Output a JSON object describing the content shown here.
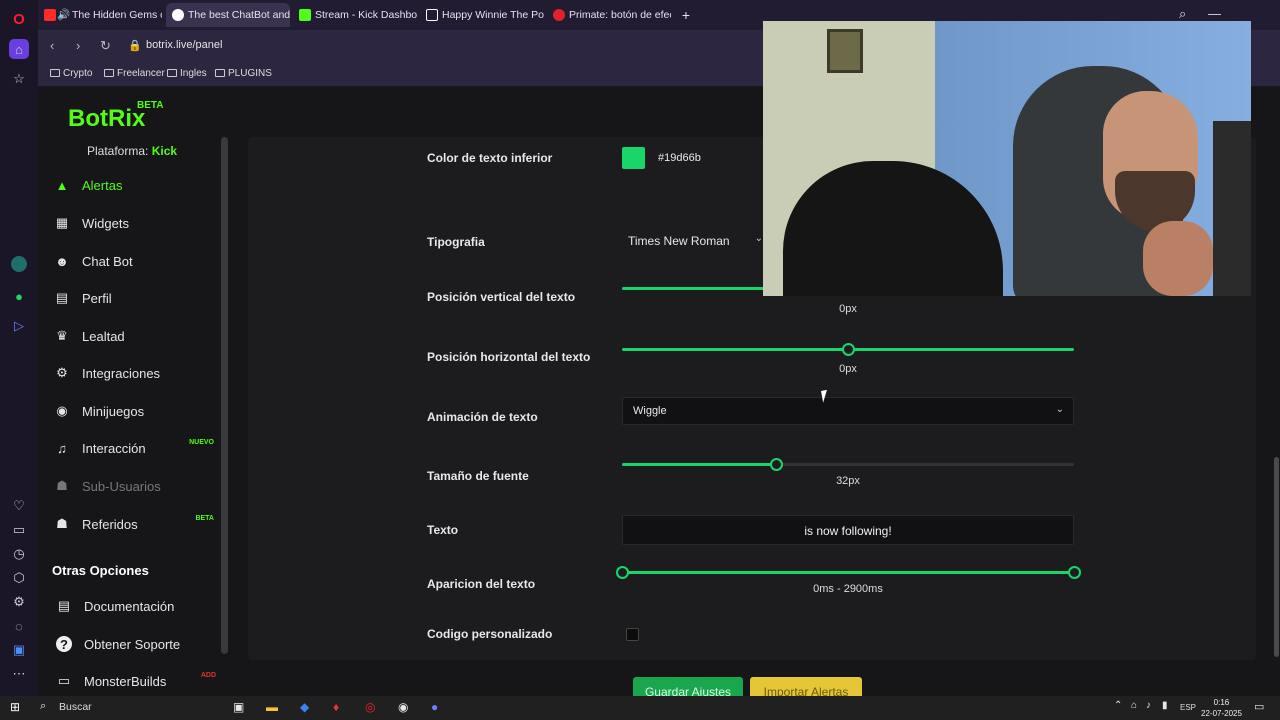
{
  "browser": {
    "tabs": [
      {
        "label": "The Hidden Gems of A",
        "fav_color": "#ff2a2a",
        "audio": "🔊"
      },
      {
        "label": "The best ChatBot and We",
        "fav_color": "#ffffff"
      },
      {
        "label": "Stream - Kick Dashboard",
        "fav_color": "#53fc18"
      },
      {
        "label": "Happy Winnie The Pooh G",
        "fav_color": "#ffffff"
      },
      {
        "label": "Primate: botón de efectos",
        "fav_color": "#e0222a"
      }
    ],
    "new_tab": "+",
    "url": "botrix.live/panel",
    "bookmarks": [
      "Crypto",
      "Freelancer",
      "Ingles",
      "PLUGINS"
    ]
  },
  "brand": {
    "name": "BotRix",
    "beta": "BETA"
  },
  "sidebar": {
    "platform_label": "Plataforma:",
    "platform_value": "Kick",
    "items": [
      {
        "label": "Alertas",
        "icon": "▲"
      },
      {
        "label": "Widgets",
        "icon": "▦"
      },
      {
        "label": "Chat Bot",
        "icon": "☻"
      },
      {
        "label": "Perfil",
        "icon": "▤"
      },
      {
        "label": "Lealtad",
        "icon": "♛"
      },
      {
        "label": "Integraciones",
        "icon": "⚙"
      },
      {
        "label": "Minijuegos",
        "icon": "◉"
      },
      {
        "label": "Interacción",
        "icon": "♫",
        "badge": "NUEVO"
      },
      {
        "label": "Sub-Usuarios",
        "icon": "☗"
      },
      {
        "label": "Referidos",
        "icon": "☗",
        "badge": "BETA"
      }
    ],
    "other_heading": "Otras Opciones",
    "other_items": [
      {
        "label": "Documentación",
        "icon": "▤"
      },
      {
        "label": "Obtener Soporte",
        "icon": "?"
      },
      {
        "label": "MonsterBuilds",
        "icon": "▭",
        "badge": "ADD"
      }
    ]
  },
  "form": {
    "color_label": "Color de texto inferior",
    "color_value": "#19d66b",
    "swatch_color": "#19d66b",
    "font_label": "Tipografia",
    "font_value": "Times New Roman",
    "vpos_label": "Posición vertical del texto",
    "vpos_value": "0px",
    "hpos_label": "Posición horizontal del texto",
    "hpos_value": "0px",
    "anim_label": "Animación de texto",
    "anim_value": "Wiggle",
    "size_label": "Tamaño de fuente",
    "size_value": "32px",
    "text_label": "Texto",
    "text_value": "is now following!",
    "appear_label": "Aparicion del texto",
    "appear_value": "0ms - 2900ms",
    "custom_label": "Codigo personalizado",
    "save_button": "Guardar Ajustes",
    "import_button": "Importar Alertas"
  },
  "taskbar": {
    "search": "Buscar",
    "lang": "ESP",
    "time": "0:16",
    "date": "22-07-2025"
  }
}
